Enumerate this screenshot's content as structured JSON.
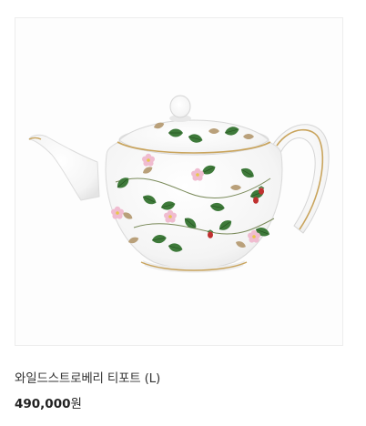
{
  "product": {
    "image": "teapot-image",
    "name": "와일드스트로베리 티포트 (L)",
    "price_value": "490,000",
    "price_unit": "원"
  },
  "colors": {
    "gold_trim": "#c9a45c",
    "leaf_green": "#3e7a3a",
    "blossom_pink": "#e6a6c0",
    "berry_red": "#c0302f"
  }
}
